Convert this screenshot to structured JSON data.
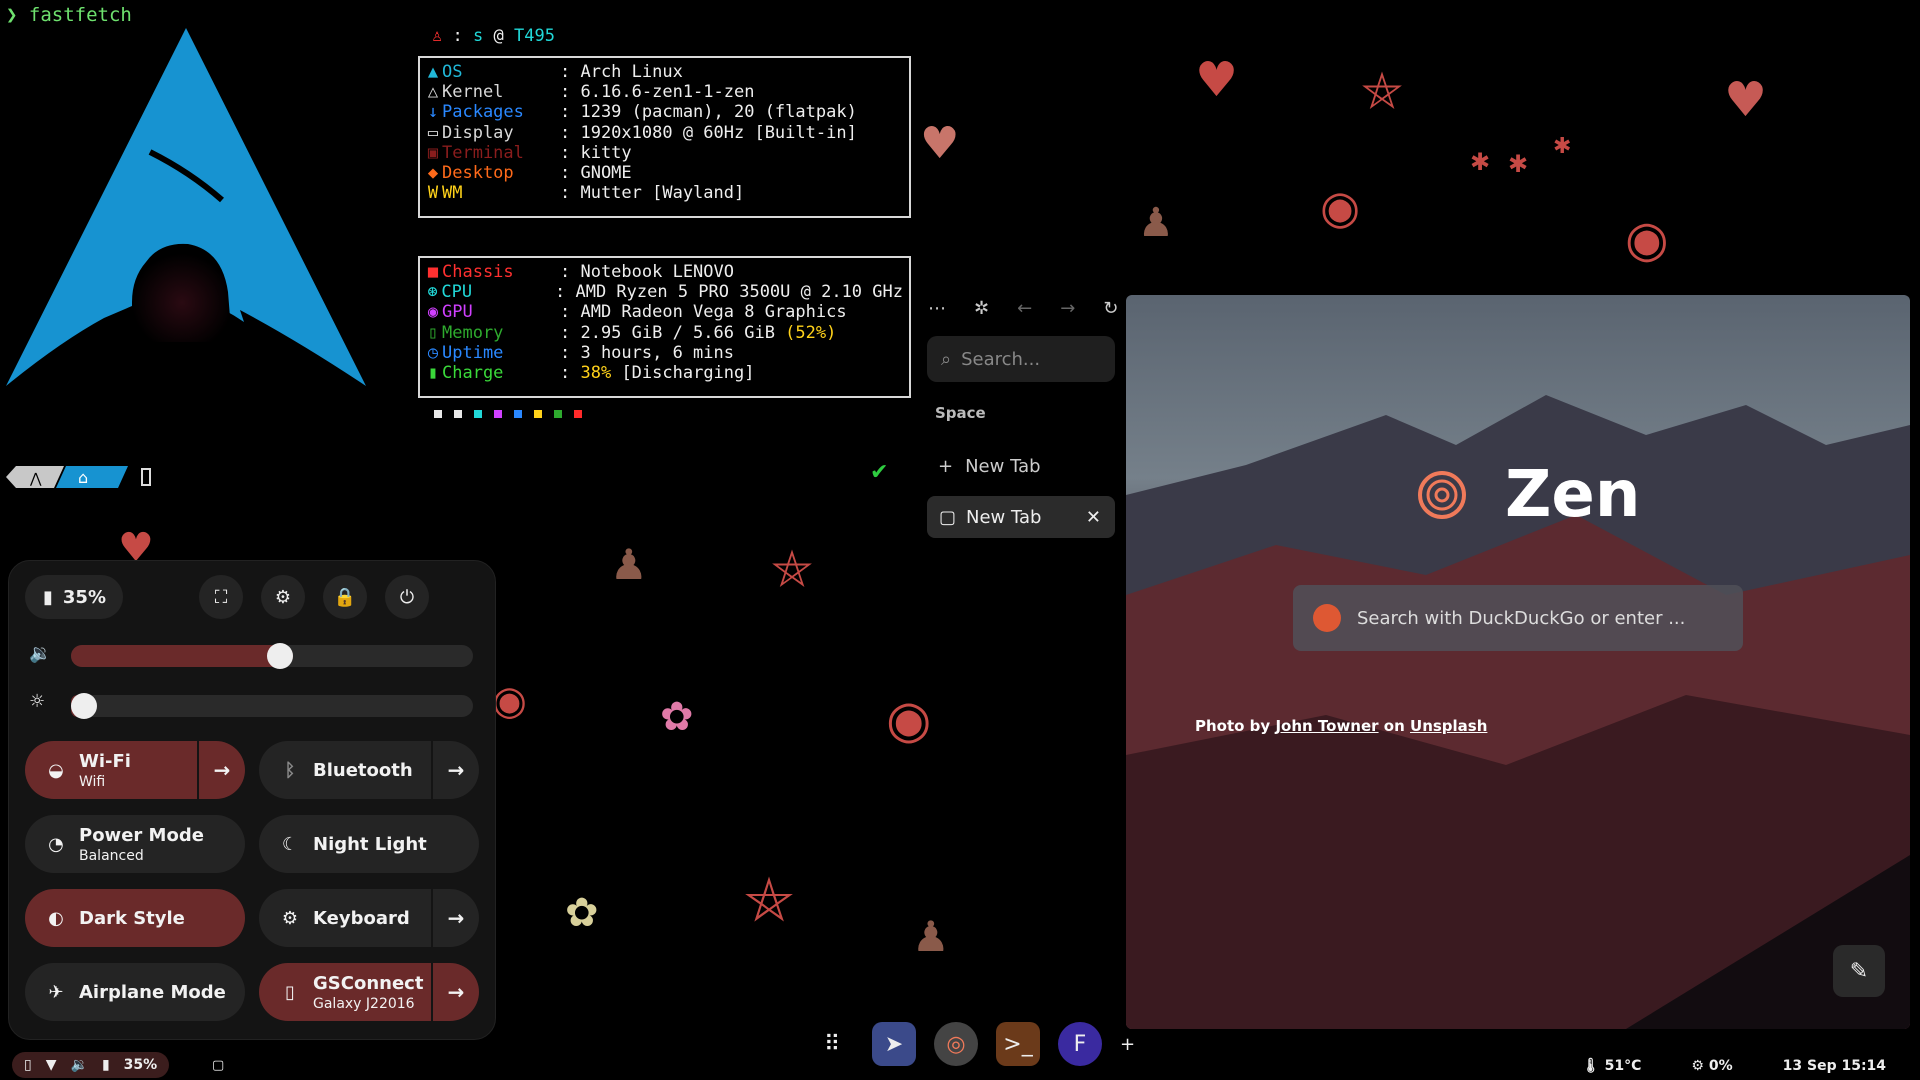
{
  "terminal": {
    "prompt_symbol": "❯",
    "command": "fastfetch"
  },
  "fastfetch": {
    "user_line": {
      "user": "s",
      "at": "@",
      "host": "T495",
      "sep": ":"
    },
    "box1": [
      {
        "icon": "▲",
        "key": "OS",
        "value": ": Arch Linux",
        "color": "#21b8d8"
      },
      {
        "icon": "△",
        "key": "Kernel",
        "value": ": 6.16.6-zen1-1-zen",
        "color": "#d8d8d8"
      },
      {
        "icon": "↓",
        "key": "Packages",
        "value": ": 1239 (pacman), 20 (flatpak)",
        "color": "#2a88ff"
      },
      {
        "icon": "▭",
        "key": "Display",
        "value": ": 1920x1080 @ 60Hz [Built-in]",
        "color": "#d8d8d8"
      },
      {
        "icon": "▣",
        "key": "Terminal",
        "value": ": kitty",
        "color": "#8a1d1d"
      },
      {
        "icon": "◆",
        "key": "Desktop",
        "value": ": GNOME",
        "color": "#ff6a1a"
      },
      {
        "icon": "W",
        "key": "WM",
        "value": ": Mutter [Wayland]",
        "color": "#ffd21a"
      }
    ],
    "box2": [
      {
        "icon": "■",
        "key": "Chassis",
        "value": ": Notebook LENOVO",
        "color": "#ff3030"
      },
      {
        "icon": "⊛",
        "key": "CPU",
        "value": ": AMD Ryzen 5 PRO 3500U @ 2.10 GHz",
        "color": "#21d8d8"
      },
      {
        "icon": "◉",
        "key": "GPU",
        "value": ": AMD Radeon Vega 8 Graphics",
        "color": "#d040ff"
      },
      {
        "icon": "▯",
        "key": "Memory",
        "value": ": 2.95 GiB / 5.66 GiB ",
        "highlight": "(52%)",
        "color": "#2eaa2e"
      },
      {
        "icon": "◷",
        "key": "Uptime",
        "value": ": 3 hours, 6 mins",
        "color": "#2a88ff"
      },
      {
        "icon": "▮",
        "key": "Charge",
        "value": ": ",
        "highlight": "38%",
        "value2": " [Discharging]",
        "color": "#3ad83a"
      }
    ],
    "palette": [
      "#e8e8e8",
      "#e8e8e8",
      "#21d8d8",
      "#d040ff",
      "#2a88ff",
      "#ffd21a",
      "#2eaa2e",
      "#ff2a2a"
    ]
  },
  "quick_settings": {
    "battery": "35%",
    "volume_level": 0.52,
    "brightness_level": 0.0,
    "tiles": {
      "wifi": {
        "label": "Wi-Fi",
        "sub": "Wifi"
      },
      "bluetooth": {
        "label": "Bluetooth"
      },
      "power_mode": {
        "label": "Power Mode",
        "sub": "Balanced"
      },
      "night_light": {
        "label": "Night Light"
      },
      "dark_style": {
        "label": "Dark Style"
      },
      "keyboard": {
        "label": "Keyboard"
      },
      "airplane": {
        "label": "Airplane Mode"
      },
      "gsconnect": {
        "label": "GSConnect",
        "sub": "Galaxy J22016"
      }
    }
  },
  "zen_sidebar": {
    "search_placeholder": "Search...",
    "space_label": "Space",
    "new_tab": "New Tab",
    "active_tab": "New Tab"
  },
  "browser": {
    "brand": "Zen",
    "search_placeholder": "Search with DuckDuckGo or enter ...",
    "credit_prefix": "Photo by",
    "credit_author": "John Towner",
    "credit_on": "on",
    "credit_site": "Unsplash"
  },
  "bottom_left_panel": {
    "battery": "35%"
  },
  "status_right": {
    "temp": "51°C",
    "cpu": "0%",
    "datetime": "13 Sep 15:14"
  },
  "colors": {
    "accent": "#6a2a2a",
    "arch_blue": "#1793d1"
  }
}
